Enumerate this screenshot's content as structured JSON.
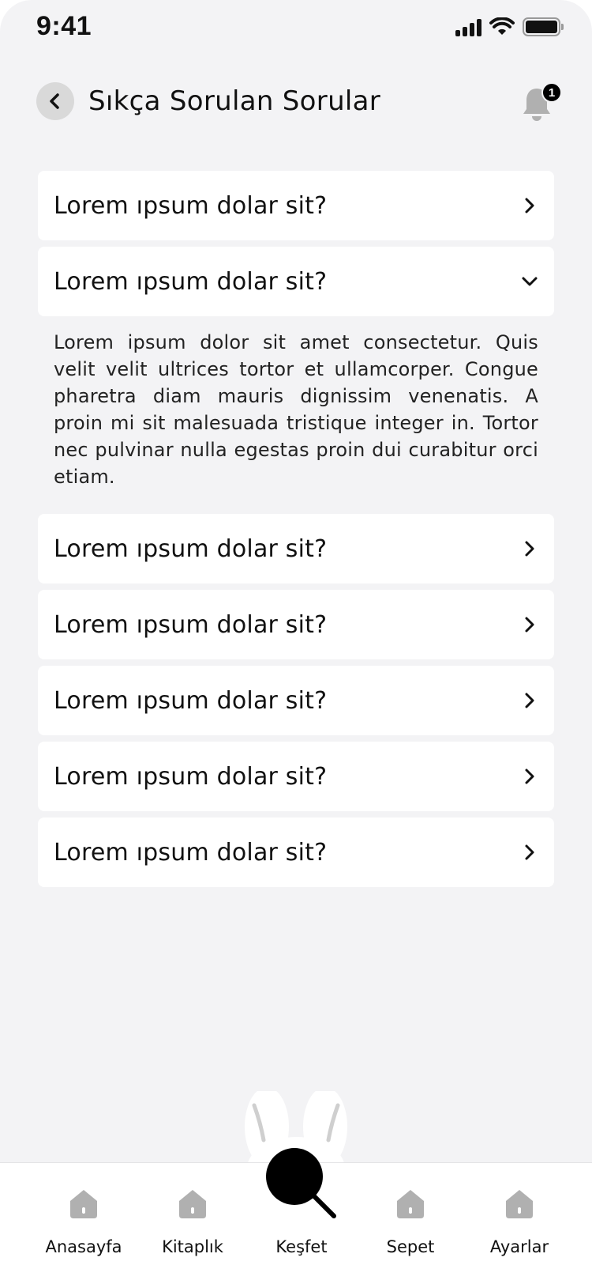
{
  "status_bar": {
    "time": "9:41"
  },
  "header": {
    "title": "Sıkça Sorulan Sorular",
    "notification_count": "1"
  },
  "faq": {
    "items": [
      {
        "question": "Lorem ıpsum dolar sit?",
        "expanded": false
      },
      {
        "question": "Lorem ıpsum dolar sit?",
        "expanded": true,
        "answer": "Lorem ipsum dolor sit amet consectetur. Quis velit velit ultrices tortor et ullamcorper. Congue pharetra diam mauris dignissim venenatis. A proin mi sit malesuada tristique integer in. Tortor nec pulvinar nulla egestas proin dui curabitur orci etiam."
      },
      {
        "question": "Lorem ıpsum dolar sit?",
        "expanded": false
      },
      {
        "question": "Lorem ıpsum dolar sit?",
        "expanded": false
      },
      {
        "question": "Lorem ıpsum dolar sit?",
        "expanded": false
      },
      {
        "question": "Lorem ıpsum dolar sit?",
        "expanded": false
      },
      {
        "question": "Lorem ıpsum dolar sit?",
        "expanded": false
      }
    ]
  },
  "bottom_nav": {
    "items": [
      {
        "label": "Anasayfa",
        "icon": "home-icon"
      },
      {
        "label": "Kitaplık",
        "icon": "home-icon"
      },
      {
        "label": "Keşfet",
        "icon": "search-icon",
        "active": true
      },
      {
        "label": "Sepet",
        "icon": "home-icon"
      },
      {
        "label": "Ayarlar",
        "icon": "home-icon"
      }
    ]
  },
  "colors": {
    "background": "#f3f3f5",
    "card": "#ffffff",
    "text": "#111111",
    "icon_gray": "#b0b0b0",
    "back_button_bg": "#d9d9d9"
  }
}
